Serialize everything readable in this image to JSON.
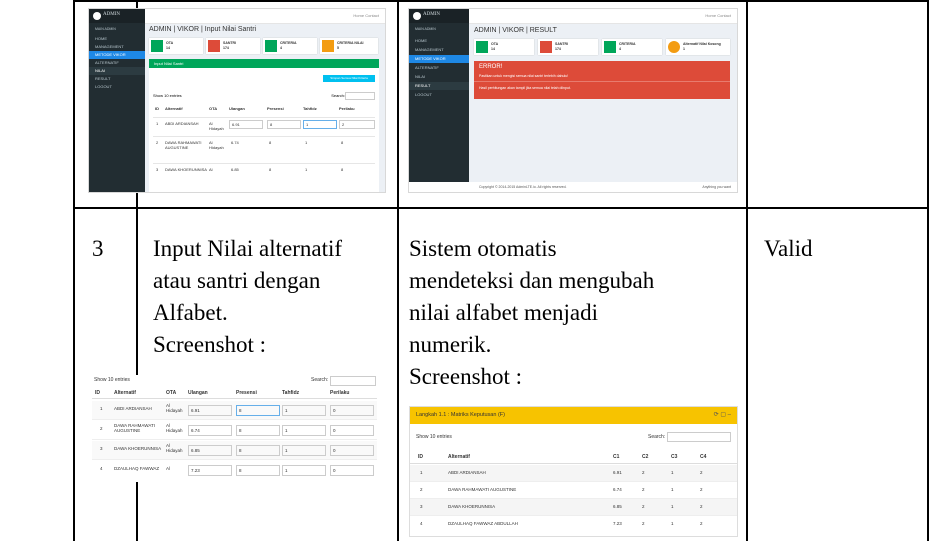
{
  "row_top": {
    "shot_input": {
      "sidebar_logo": "ADMIN",
      "sidebar_header": "MAIN ADMIN",
      "sidebar_items": [
        "HOME",
        "MANAGEMENT",
        "METODE VIKOR",
        "ALTERNATIF",
        "NILAI",
        "RESULT",
        "LOGOUT"
      ],
      "top_links": "Home   Contact",
      "title": "ADMIN | VIKOR | Input Nilai Santri",
      "info_boxes": [
        {
          "label": "OTA",
          "value": "14",
          "color": "#00a65a"
        },
        {
          "label": "SANTRI",
          "value": "174",
          "color": "#dd4b39"
        },
        {
          "label": "CRITERIA",
          "value": "4",
          "color": "#00a65a"
        },
        {
          "label": "CRITERIA NILAI",
          "value": "5",
          "color": "#f39c12"
        }
      ],
      "panel_title": "Input Nilai Santri",
      "button": "Simpan Semua Nilai Kriteria",
      "show_entries": "Show  10  entries",
      "search": "Search:",
      "headers": [
        "ID",
        "Alternatif",
        "OTA",
        "Ulangan",
        "Presensi",
        "Tahfidz",
        "Perilaku"
      ],
      "rows": [
        [
          "1",
          "ABDI ARDIANSAH",
          "Al Hidayah",
          "6.91",
          "8",
          "1",
          "2"
        ],
        [
          "2",
          "DAWA RAHMAWATI AUGUSTINE",
          "Al Hidayah",
          "6.74",
          "8",
          "1",
          "8"
        ],
        [
          "3",
          "DAWA KHOERUNNISA",
          "Al",
          "6.85",
          "8",
          "1",
          "8"
        ]
      ]
    },
    "shot_result": {
      "sidebar_logo": "ADMIN",
      "sidebar_header": "MAIN ADMIN",
      "sidebar_items": [
        "HOME",
        "MANAGEMENT",
        "METODE VIKOR",
        "ALTERNATIF",
        "NILAI",
        "RESULT",
        "LOGOUT"
      ],
      "top_links": "Home   Contact",
      "title": "ADMIN | VIKOR | RESULT",
      "info_boxes": [
        {
          "label": "OTA",
          "value": "14",
          "color": "#00a65a"
        },
        {
          "label": "SANTRI",
          "value": "174",
          "color": "#dd4b39"
        },
        {
          "label": "CRITERIA",
          "value": "4",
          "color": "#00a65a"
        },
        {
          "label": "Alternatif Nilai Kosong",
          "value": "1",
          "color": "#f39c12"
        }
      ],
      "error_title": "ERROR!",
      "error_line1": "Pastikan untuk mengisi semua nilai santri terlebih dahulu!",
      "error_line2": "Hasil perhitungan akan tampil jika semua nilai telah diinput.",
      "footer": "Copyright © 2014-2015 AdminLTE.io. All rights reserved.",
      "footer_right": "Anything you want"
    }
  },
  "row_main": {
    "number": "3",
    "test_case": {
      "lines": [
        "Input Nilai alternatif",
        "atau santri dengan",
        "Alfabet.",
        "Screenshot :"
      ]
    },
    "expected": {
      "lines": [
        "Sistem otomatis",
        "mendeteksi dan mengubah",
        "nilai alfabet menjadi",
        "numerik.",
        "Screenshot :"
      ]
    },
    "result": "Valid",
    "shot_alpha": {
      "show_entries": "Show  10  entries",
      "search": "Search:",
      "headers": [
        "ID",
        "Alternatif",
        "OTA",
        "Ulangan",
        "Presensi",
        "Tahfidz",
        "Perilaku"
      ],
      "rows": [
        [
          "1",
          "ABDI ARDIANSAH",
          "Al Hidayah",
          "6.91",
          "8",
          "1",
          "0"
        ],
        [
          "2",
          "DAWA RAHMAWATI AUGUSTINE",
          "Al Hidayah",
          "6.74",
          "8",
          "1",
          "0"
        ],
        [
          "3",
          "DAWA KHOERUNNISA",
          "Al Hidayah",
          "6.85",
          "8",
          "1",
          "0"
        ],
        [
          "4",
          "DZAULHAQ FAWWAZ",
          "Al",
          "7.23",
          "8",
          "1",
          "0"
        ]
      ]
    },
    "shot_matrix": {
      "title": "Langkah 1.1 : Matriks Keputusan (F)",
      "show_entries": "Show  10  entries",
      "search": "Search:",
      "headers": [
        "ID",
        "Alternatif",
        "C1",
        "C2",
        "C3",
        "C4"
      ],
      "rows": [
        [
          "1",
          "ABDI ARDIANSAH",
          "6.91",
          "2",
          "1",
          "2"
        ],
        [
          "2",
          "DAWA RAHMAWATI AUGUSTINE",
          "6.74",
          "2",
          "1",
          "2"
        ],
        [
          "3",
          "DAWA KHOERUNNISA",
          "6.85",
          "2",
          "1",
          "2"
        ],
        [
          "4",
          "DZAULHAQ FAWWAZ ABDULLAH",
          "7.23",
          "2",
          "1",
          "2"
        ]
      ]
    }
  }
}
